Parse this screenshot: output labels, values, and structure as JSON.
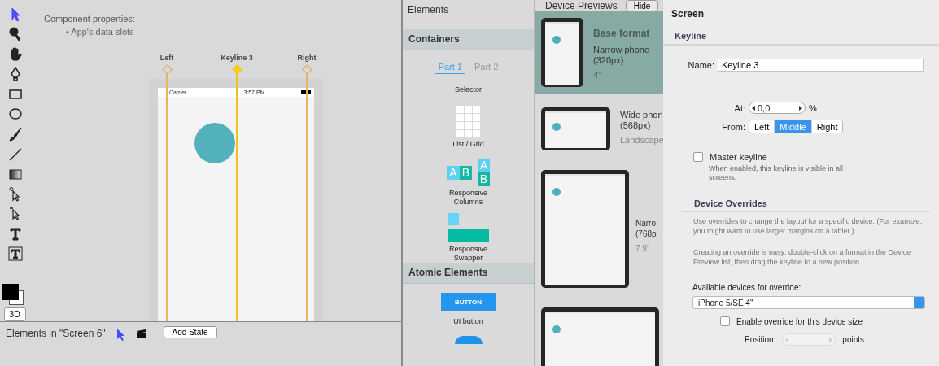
{
  "toolbar": {
    "tools": [
      {
        "kind": "arrow",
        "selected": true
      },
      {
        "kind": "magnifier",
        "selected": false
      },
      {
        "kind": "hand",
        "selected": false
      },
      {
        "kind": "pen",
        "selected": false
      },
      {
        "kind": "rectangle",
        "selected": false
      },
      {
        "kind": "ellipse",
        "selected": false
      },
      {
        "kind": "brush",
        "selected": false
      },
      {
        "kind": "line",
        "selected": false
      },
      {
        "kind": "gradient",
        "selected": false
      },
      {
        "kind": "direct-select",
        "selected": false
      },
      {
        "kind": "sub-select",
        "selected": false
      },
      {
        "kind": "text",
        "selected": false
      },
      {
        "kind": "text-box",
        "selected": false
      }
    ],
    "mode_button": "3D"
  },
  "canvas": {
    "heading": "Component properties:",
    "bullets": [
      "• App's data slots"
    ],
    "keylines": [
      {
        "label": "Left",
        "selected": false
      },
      {
        "label": "Keyline 3",
        "selected": true
      },
      {
        "label": "Right",
        "selected": false
      }
    ],
    "phone": {
      "carrier": "Carrier",
      "time": "3:57 PM"
    }
  },
  "bottom_bar": {
    "label": "Elements in \"Screen 6\"",
    "button": "Add State"
  },
  "elements_panel": {
    "title": "Elements",
    "sections": [
      {
        "title": "Containers",
        "tabs": [
          {
            "label": "Part 1",
            "selected": true
          },
          {
            "label": "Part 2",
            "selected": false
          }
        ],
        "items": [
          {
            "kind": "plain",
            "label": "Selector"
          },
          {
            "kind": "grid",
            "label": "List / Grid"
          },
          {
            "kind": "columns",
            "label": "Responsive Columns",
            "letters": [
              "A",
              "B",
              "A",
              "B"
            ]
          },
          {
            "kind": "swapper",
            "label": "Responsive Swapper"
          }
        ]
      },
      {
        "title": "Atomic Elements",
        "items": [
          {
            "kind": "button",
            "sample": "BUTTON",
            "label": "UI button"
          },
          {
            "kind": "circle"
          }
        ]
      }
    ]
  },
  "device_previews": {
    "title": "Device Previews",
    "hide_button": "Hide",
    "devices": [
      {
        "kind": "phone",
        "selected": true,
        "title": "Base format",
        "name": "Narrow phone",
        "size": "(320px)",
        "note": "4\""
      },
      {
        "kind": "landscape",
        "selected": false,
        "name": "Wide phon",
        "size": "(568px)",
        "note": "Landscape"
      },
      {
        "kind": "tablet",
        "selected": false,
        "name": "Narro",
        "size": "(768p",
        "note": "7.9\""
      },
      {
        "kind": "large",
        "selected": false
      }
    ]
  },
  "inspector": {
    "title": "Screen",
    "keyline": {
      "heading": "Keyline",
      "name_label": "Name:",
      "name_value": "Keyline 3",
      "at_label": "At:",
      "at_value": "0,0",
      "at_unit": "%",
      "from_label": "From:",
      "from_options": [
        {
          "label": "Left",
          "selected": false
        },
        {
          "label": "Middle",
          "selected": true
        },
        {
          "label": "Right",
          "selected": false
        }
      ],
      "master": {
        "label": "Master keyline",
        "checked": false,
        "hint": "When enabled, this keyline is visible in all screens."
      }
    },
    "overrides": {
      "heading": "Device Overrides",
      "paragraphs": [
        "Use overrides to change the layout for a specific device. (For example, you might want to use larger margins on a tablet.)",
        "Creating an override is easy: double-click on a format in the Device Preview list, then drag the keyline to a new position."
      ],
      "devices_label": "Available devices for override:",
      "device_value": "iPhone 5/SE 4\"",
      "enable": {
        "label": "Enable override for this device size",
        "checked": false
      },
      "position_label": "Position:",
      "position_disabled": true,
      "position_unit": "points"
    }
  }
}
